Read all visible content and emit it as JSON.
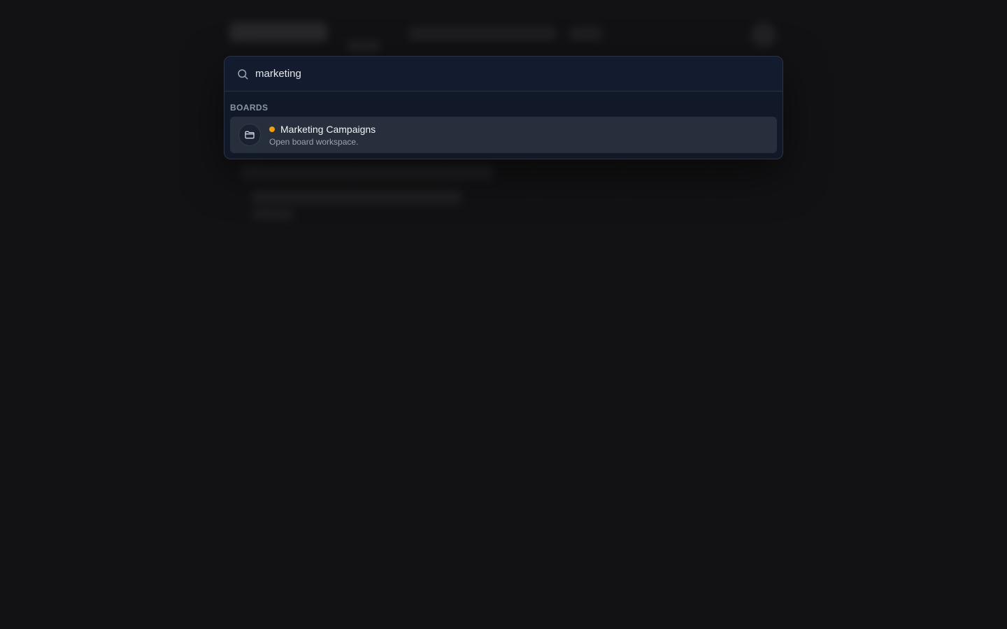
{
  "search": {
    "value": "marketing",
    "placeholder": ""
  },
  "sections": [
    {
      "label": "BOARDS",
      "items": [
        {
          "title": "Marketing Campaigns",
          "subtitle": "Open board workspace.",
          "icon": "folder-icon",
          "status_color": "#f59e0b"
        }
      ]
    }
  ],
  "colors": {
    "accent_dot": "#f59e0b",
    "palette_bg": "#111827",
    "selected_bg": "#272f3d"
  }
}
